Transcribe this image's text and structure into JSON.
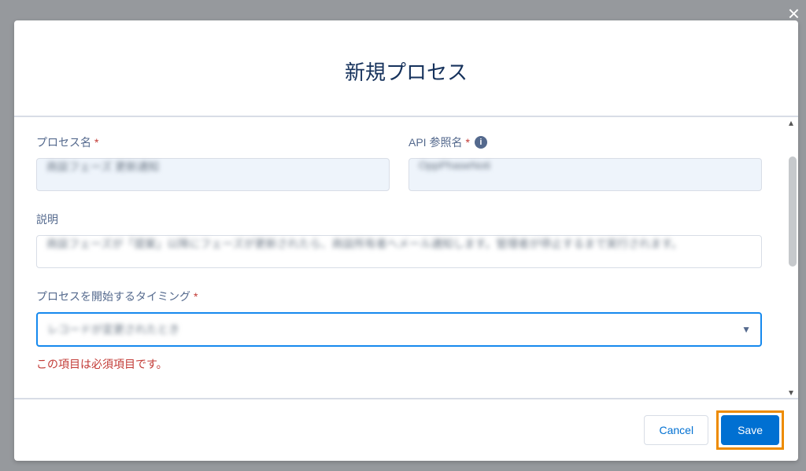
{
  "modal": {
    "title": "新規プロセス",
    "close_label": "×"
  },
  "form": {
    "process_name": {
      "label": "プロセス名",
      "value": "商談フェーズ 更新通知"
    },
    "api_name": {
      "label": "API 参照名",
      "value": "OppPhaseNoti"
    },
    "description": {
      "label": "説明",
      "value": "商談フェーズが「提案」以降にフェーズが更新されたら、商談所有者へメール通知します。管理者が停止するまで実行されます。"
    },
    "start_timing": {
      "label": "プロセスを開始するタイミング",
      "value": "レコードが変更されたとき",
      "error": "この項目は必須項目です。"
    }
  },
  "footer": {
    "cancel": "Cancel",
    "save": "Save"
  }
}
